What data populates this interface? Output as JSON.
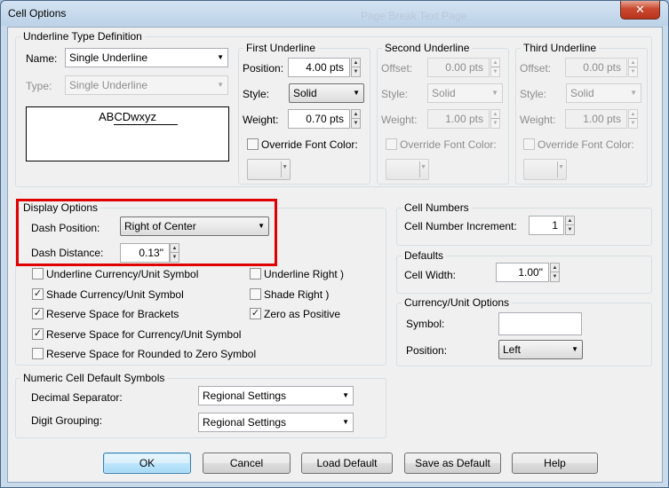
{
  "window": {
    "title": "Cell Options",
    "background_title": "Page Break Text Page",
    "close_symbol": "✕"
  },
  "underline_type": {
    "group_label": "Underline Type Definition",
    "name_label": "Name:",
    "name_value": "Single Underline",
    "type_label": "Type:",
    "type_value": "Single Underline",
    "preview_text": "ABCDwxyz"
  },
  "first_underline": {
    "group_label": "First Underline",
    "position_label": "Position:",
    "position_value": "4.00 pts",
    "style_label": "Style:",
    "style_value": "Solid",
    "weight_label": "Weight:",
    "weight_value": "0.70 pts",
    "override_label": "Override Font Color:",
    "override_checked": false
  },
  "second_underline": {
    "group_label": "Second Underline",
    "offset_label": "Offset:",
    "offset_value": "0.00 pts",
    "style_label": "Style:",
    "style_value": "Solid",
    "weight_label": "Weight:",
    "weight_value": "1.00 pts",
    "override_label": "Override Font Color:",
    "override_checked": false
  },
  "third_underline": {
    "group_label": "Third Underline",
    "offset_label": "Offset:",
    "offset_value": "0.00 pts",
    "style_label": "Style:",
    "style_value": "Solid",
    "weight_label": "Weight:",
    "weight_value": "1.00 pts",
    "override_label": "Override Font Color:",
    "override_checked": false
  },
  "display_options": {
    "group_label": "Display Options",
    "dash_position_label": "Dash Position:",
    "dash_position_value": "Right of Center",
    "dash_distance_label": "Dash Distance:",
    "dash_distance_value": "0.13\"",
    "checkboxes": [
      {
        "label": "Underline Currency/Unit Symbol",
        "checked": false
      },
      {
        "label": "Underline Right )",
        "checked": false
      },
      {
        "label": "Shade Currency/Unit Symbol",
        "checked": true
      },
      {
        "label": "Shade Right )",
        "checked": false
      },
      {
        "label": "Reserve Space for Brackets",
        "checked": true
      },
      {
        "label": "Zero as Positive",
        "checked": true
      },
      {
        "label": "Reserve Space for Currency/Unit Symbol",
        "checked": true
      },
      {
        "label": "Reserve Space for Rounded to Zero Symbol",
        "checked": false
      }
    ],
    "check_symbol": "✓"
  },
  "cell_numbers": {
    "group_label": "Cell Numbers",
    "increment_label": "Cell Number Increment:",
    "increment_value": "1"
  },
  "defaults": {
    "group_label": "Defaults",
    "cell_width_label": "Cell Width:",
    "cell_width_value": "1.00\""
  },
  "currency_unit": {
    "group_label": "Currency/Unit Options",
    "symbol_label": "Symbol:",
    "symbol_value": "",
    "position_label": "Position:",
    "position_value": "Left"
  },
  "numeric_symbols": {
    "group_label": "Numeric Cell Default Symbols",
    "decimal_label": "Decimal Separator:",
    "decimal_value": "Regional Settings",
    "grouping_label": "Digit Grouping:",
    "grouping_value": "Regional Settings"
  },
  "buttons": {
    "ok": "OK",
    "cancel": "Cancel",
    "load_default": "Load Default",
    "save_default": "Save as Default",
    "help": "Help"
  },
  "icons": {
    "dropdown": "▼",
    "spin_up": "▲",
    "spin_down": "▼"
  }
}
